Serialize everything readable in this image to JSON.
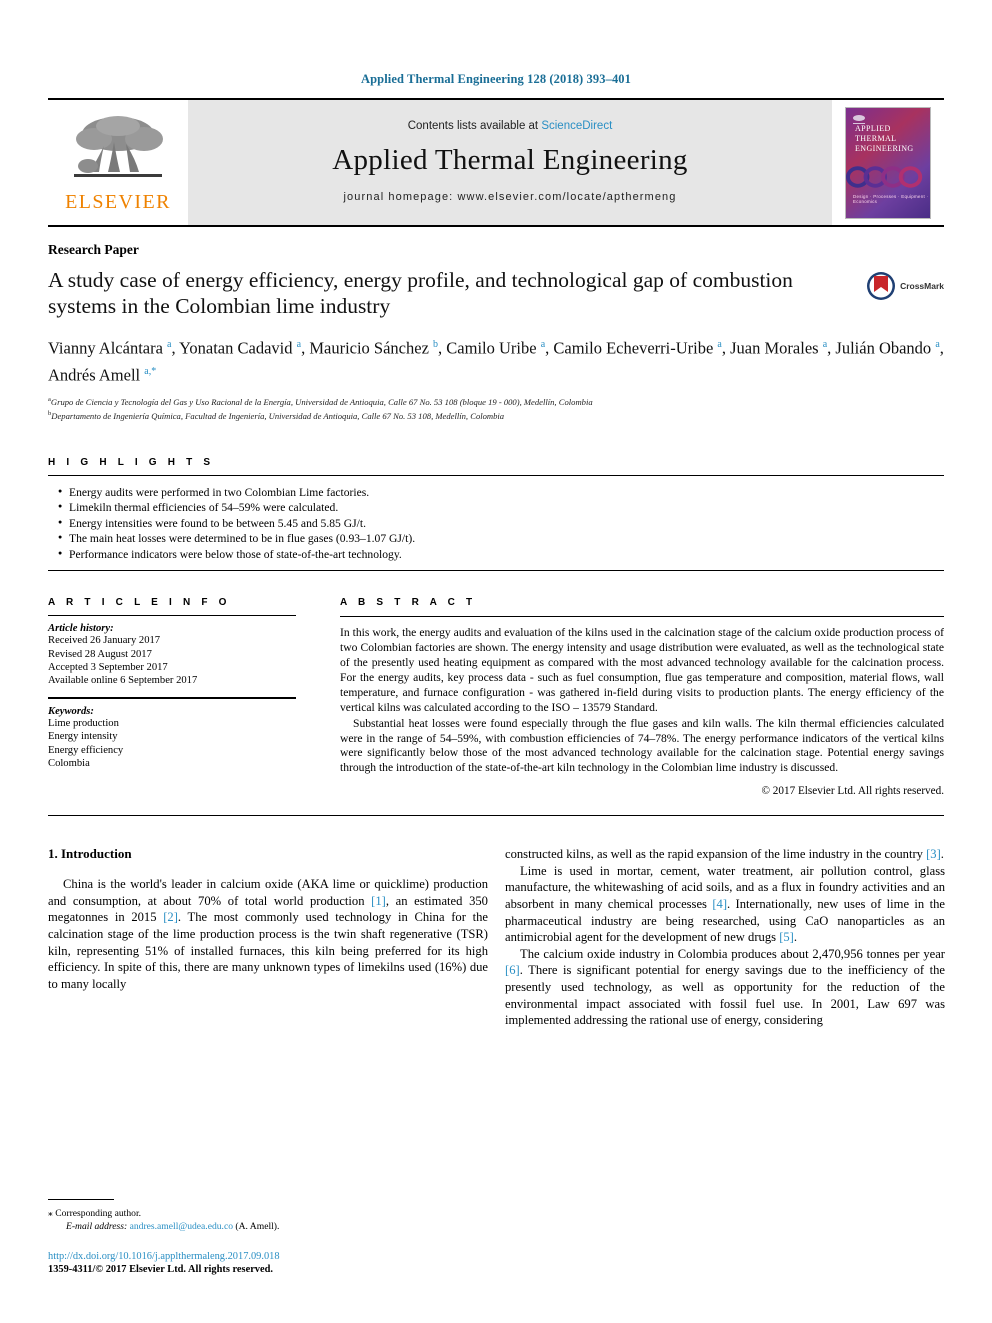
{
  "running_head": "Applied Thermal Engineering 128 (2018) 393–401",
  "masthead": {
    "contents_prefix": "Contents lists available at ",
    "sciencedirect": "ScienceDirect",
    "journal_title": "Applied Thermal Engineering",
    "homepage": "journal homepage: www.elsevier.com/locate/apthermeng",
    "elsevier_wordmark": "ELSEVIER",
    "cover": {
      "title_line1": "APPLIED",
      "title_line2": "THERMAL",
      "title_line3": "ENGINEERING",
      "footer": "Design · Processes · Equipment · Economics"
    }
  },
  "article": {
    "type": "Research Paper",
    "title": "A study case of energy efficiency, energy profile, and technological gap of combustion systems in the Colombian lime industry",
    "crossmark_label": "CrossMark",
    "authors_line1": "Vianny Alcántara",
    "authors_html": "Vianny Alcántara <sup>a</sup>, Yonatan Cadavid <sup>a</sup>, Mauricio Sánchez <sup>b</sup>, Camilo Uribe <sup>a</sup>, Camilo Echeverri-Uribe <sup>a</sup>, Juan Morales <sup>a</sup>, Julián Obando <sup>a</sup>, Andrés Amell <sup>a,*</sup>",
    "affiliations": [
      "Grupo de Ciencia y Tecnología del Gas y Uso Racional de la Energía, Universidad de Antioquia, Calle 67 No. 53 108 (bloque 19 - 000), Medellín, Colombia",
      "Departamento de Ingeniería Química, Facultad de Ingeniería, Universidad de Antioquia, Calle 67 No. 53 108, Medellín, Colombia"
    ],
    "affiliation_marks": [
      "a",
      "b"
    ]
  },
  "highlights": {
    "label": "H I G H L I G H T S",
    "items": [
      "Energy audits were performed in two Colombian Lime factories.",
      "Limekiln thermal efficiencies of 54–59% were calculated.",
      "Energy intensities were found to be between 5.45 and 5.85 GJ/t.",
      "The main heat losses were determined to be in flue gases (0.93–1.07 GJ/t).",
      "Performance indicators were below those of state-of-the-art technology."
    ]
  },
  "article_info": {
    "label": "A R T I C L E   I N F O",
    "history_head": "Article history:",
    "history": [
      "Received 26 January 2017",
      "Revised 28 August 2017",
      "Accepted 3 September 2017",
      "Available online 6 September 2017"
    ],
    "keywords_head": "Keywords:",
    "keywords": [
      "Lime production",
      "Energy intensity",
      "Energy efficiency",
      "Colombia"
    ]
  },
  "abstract": {
    "label": "A B S T R A C T",
    "paragraph1": "In this work, the energy audits and evaluation of the kilns used in the calcination stage of the calcium oxide production process of two Colombian factories are shown. The energy intensity and usage distribution were evaluated, as well as the technological state of the presently used heating equipment as compared with the most advanced technology available for the calcination process. For the energy audits, key process data - such as fuel consumption, flue gas temperature and composition, material flows, wall temperature, and furnace configuration - was gathered in-field during visits to production plants. The energy efficiency of the vertical kilns was calculated according to the ISO – 13579 Standard.",
    "paragraph2": "Substantial heat losses were found especially through the flue gases and kiln walls. The kiln thermal efficiencies calculated were in the range of 54–59%, with combustion efficiencies of 74–78%. The energy performance indicators of the vertical kilns were significantly below those of the most advanced technology available for the calcination stage. Potential energy savings through the introduction of the state-of-the-art kiln technology in the Colombian lime industry is discussed.",
    "copyright": "© 2017 Elsevier Ltd. All rights reserved."
  },
  "body": {
    "section_heading": "1. Introduction",
    "left_paragraph_html": "China is the world's leader in calcium oxide (AKA lime or quicklime) production and consumption, at about 70% of total world production <span class=\"ref\">[1]</span>, an estimated 350 megatonnes in 2015 <span class=\"ref\">[2]</span>. The most commonly used technology in China for the calcination stage of the lime production process is the twin shaft regenerative (TSR) kiln, representing 51% of installed furnaces, this kiln being preferred for its high efficiency. In spite of this, there are many unknown types of limekilns used (16%) due to many locally",
    "right_paragraph1_html": "constructed kilns, as well as the rapid expansion of the lime industry in the country <span class=\"ref\">[3]</span>.",
    "right_paragraph2_html": "Lime is used in mortar, cement, water treatment, air pollution control, glass manufacture, the whitewashing of acid soils, and as a flux in foundry activities and an absorbent in many chemical processes <span class=\"ref\">[4]</span>. Internationally, new uses of lime in the pharmaceutical industry are being researched, using CaO nanoparticles as an antimicrobial agent for the development of new drugs <span class=\"ref\">[5]</span>.",
    "right_paragraph3_html": "The calcium oxide industry in Colombia produces about 2,470,956 tonnes per year <span class=\"ref\">[6]</span>. There is significant potential for energy savings due to the inefficiency of the presently used technology, as well as opportunity for the reduction of the environmental impact associated with fossil fuel use. In 2001, Law 697 was implemented addressing the rational use of energy, considering"
  },
  "footnote": {
    "corresponding": "Corresponding author.",
    "email_label": "E-mail address:",
    "email": "andres.amell@udea.edu.co",
    "email_suffix": " (A. Amell).",
    "doi": "http://dx.doi.org/10.1016/j.applthermaleng.2017.09.018",
    "issn": "1359-4311/© 2017 Elsevier Ltd. All rights reserved."
  },
  "colors": {
    "link": "#2a8fc4",
    "running_head": "#1a6e96",
    "elsevier_orange": "#ef8200",
    "masthead_bg": "#e6e6e6"
  }
}
